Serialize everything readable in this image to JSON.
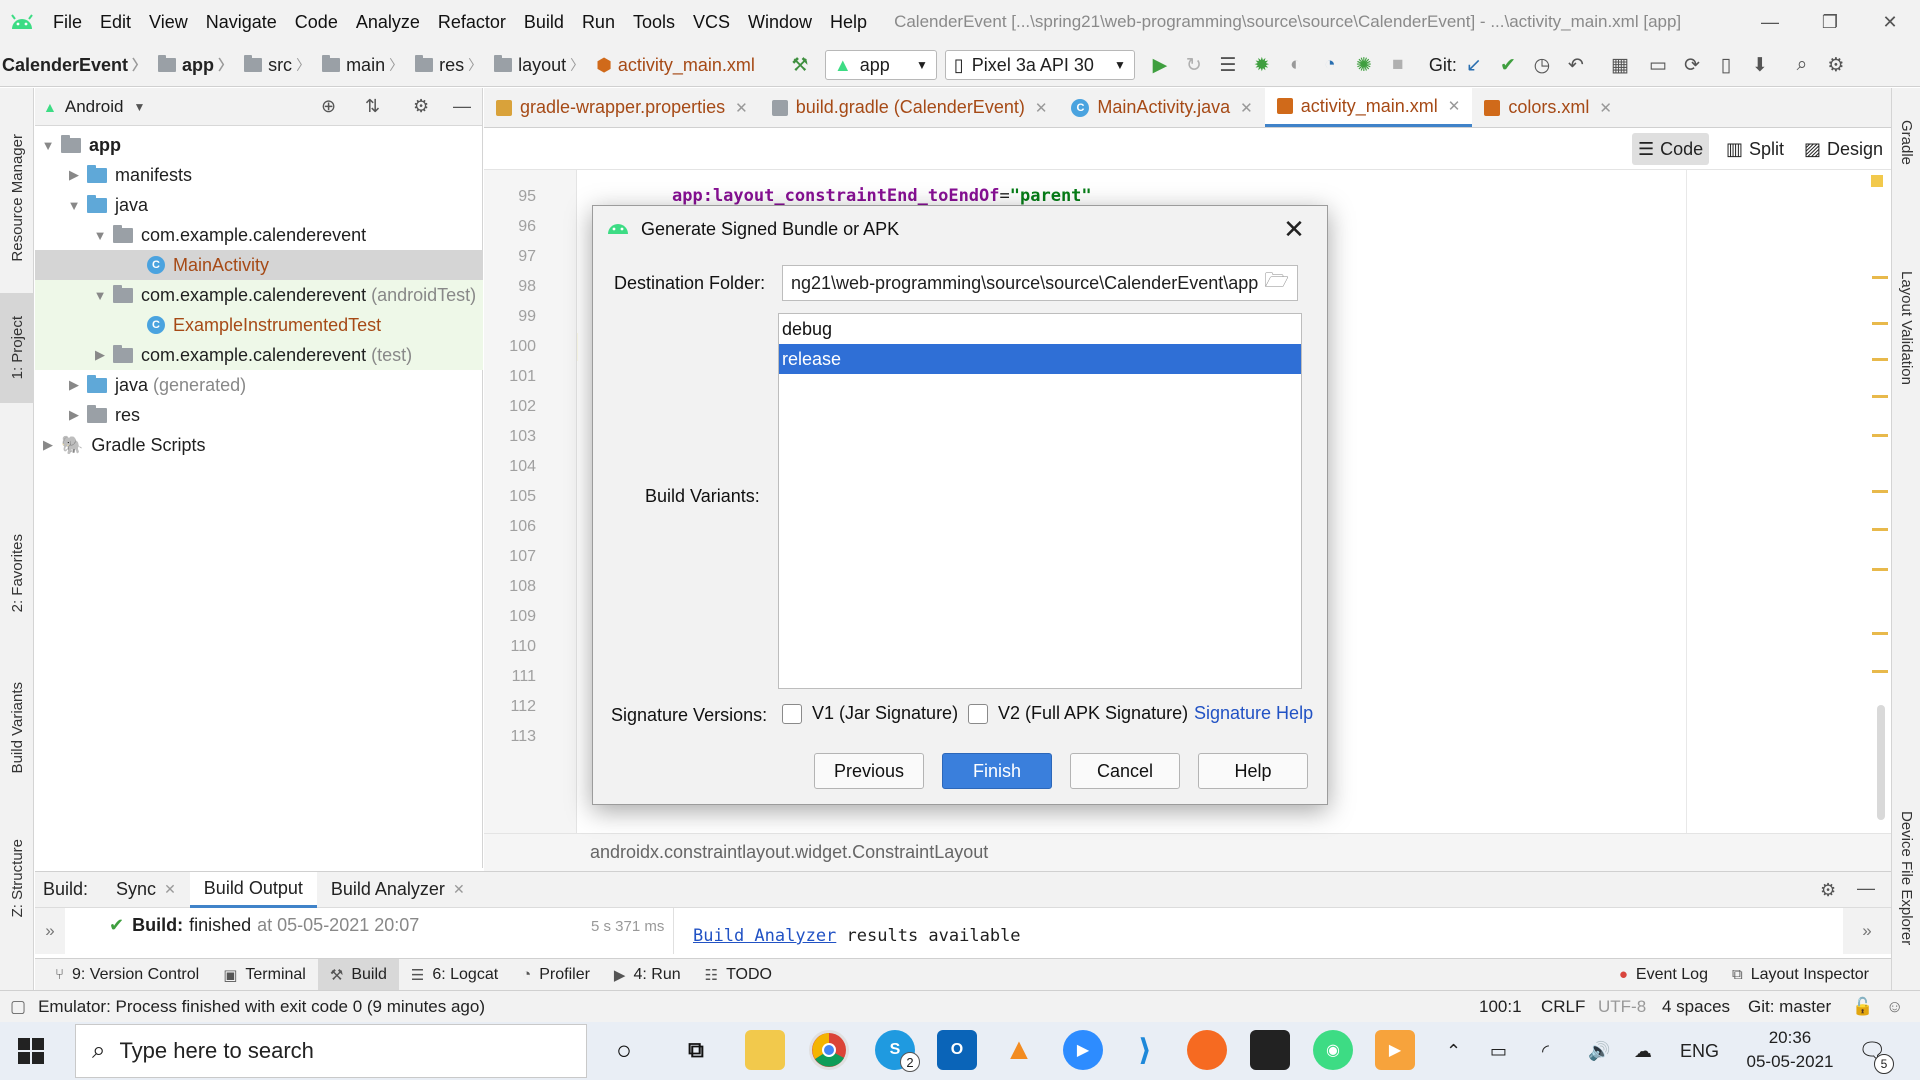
{
  "menubar": {
    "items": [
      "File",
      "Edit",
      "View",
      "Navigate",
      "Code",
      "Analyze",
      "Refactor",
      "Build",
      "Run",
      "Tools",
      "VCS",
      "Window",
      "Help"
    ],
    "title": "CalenderEvent [...\\spring21\\web-programming\\source\\source\\CalenderEvent] - ...\\activity_main.xml [app]"
  },
  "navbar": {
    "crumbs": [
      "CalenderEvent",
      "app",
      "src",
      "main",
      "res",
      "layout",
      "activity_main.xml"
    ],
    "run_config": "app",
    "device": "Pixel 3a API 30",
    "git_label": "Git:"
  },
  "project": {
    "view_mode": "Android",
    "tree": [
      {
        "label": "app",
        "bold": true
      },
      {
        "label": "manifests"
      },
      {
        "label": "java"
      },
      {
        "label": "com.example.calenderevent"
      },
      {
        "label": "MainActivity"
      },
      {
        "label": "com.example.calenderevent",
        "suffix": "(androidTest)"
      },
      {
        "label": "ExampleInstrumentedTest"
      },
      {
        "label": "com.example.calenderevent",
        "suffix": "(test)"
      },
      {
        "label": "java",
        "suffix": "(generated)"
      },
      {
        "label": "res"
      },
      {
        "label": "Gradle Scripts"
      }
    ]
  },
  "left_stripe": {
    "resource_manager": "Resource Manager",
    "project": "1: Project",
    "favorites": "2: Favorites",
    "build_variants": "Build Variants",
    "structure": "Z: Structure"
  },
  "right_stripe": {
    "gradle": "Gradle",
    "layout_validation": "Layout Validation",
    "device_file_explorer": "Device File Explorer"
  },
  "editor": {
    "tabs": [
      {
        "label": "gradle-wrapper.properties"
      },
      {
        "label": "build.gradle (CalenderEvent)"
      },
      {
        "label": "MainActivity.java"
      },
      {
        "label": "activity_main.xml",
        "active": true
      },
      {
        "label": "colors.xml"
      }
    ],
    "view_modes": [
      "Code",
      "Split",
      "Design"
    ],
    "line_numbers": [
      "95",
      "96",
      "97",
      "98",
      "99",
      "100",
      "101",
      "102",
      "103",
      "104",
      "105",
      "106",
      "107",
      "108",
      "109",
      "110",
      "111",
      "112",
      "113"
    ],
    "code_line_95_attr": "app:layout_constraintEnd_toEndOf",
    "code_line_95_eq": "=",
    "code_line_95_value": "\"parent\"",
    "bottom_breadcrumb": "androidx.constraintlayout.widget.ConstraintLayout"
  },
  "dialog": {
    "title": "Generate Signed Bundle or APK",
    "destination_label": "Destination Folder:",
    "destination_value": "ng21\\web-programming\\source\\source\\CalenderEvent\\app",
    "build_variants_label": "Build Variants:",
    "variants": [
      {
        "label": "debug",
        "selected": false
      },
      {
        "label": "release",
        "selected": true
      }
    ],
    "signature_label": "Signature Versions:",
    "v1_label": "V1 (Jar Signature)",
    "v2_label": "V2 (Full APK Signature)",
    "v1_checked": false,
    "v2_checked": false,
    "signature_help": "Signature Help",
    "buttons": {
      "previous": "Previous",
      "finish": "Finish",
      "cancel": "Cancel",
      "help": "Help"
    }
  },
  "build_panel": {
    "label": "Build:",
    "tabs": [
      "Sync",
      "Build Output",
      "Build Analyzer"
    ],
    "status_bold": "Build:",
    "status_text": "finished",
    "status_time": "at 05-05-2021 20:07",
    "duration": "5 s 371 ms",
    "analyzer_link": "Build Analyzer",
    "analyzer_text": "results available"
  },
  "tool_windows": {
    "version_control": "9: Version Control",
    "terminal": "Terminal",
    "build": "Build",
    "logcat": "6: Logcat",
    "profiler": "Profiler",
    "run": "4: Run",
    "todo": "TODO",
    "event_log": "Event Log",
    "layout_inspector": "Layout Inspector"
  },
  "statusbar": {
    "message": "Emulator: Process finished with exit code 0 (9 minutes ago)",
    "position": "100:1",
    "line_sep": "CRLF",
    "encoding": "UTF-8",
    "indent": "4 spaces",
    "git": "Git: master"
  },
  "taskbar": {
    "search_placeholder": "Type here to search",
    "lang": "ENG",
    "time": "20:36",
    "date": "05-05-2021",
    "notif_count": "5",
    "skype_badge": "2"
  },
  "colors": {
    "accent": "#3a7fdc",
    "selection": "#2f6fd6",
    "link": "#2152c4",
    "android_green": "#3ddc84"
  }
}
